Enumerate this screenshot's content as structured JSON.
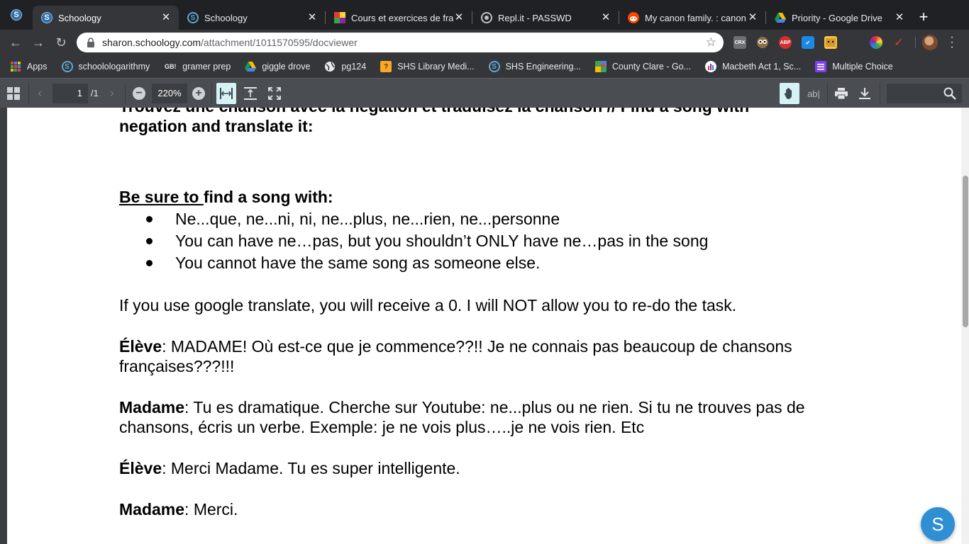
{
  "browser": {
    "pinned_tab": {
      "icon": "schoology-icon"
    },
    "tabs": [
      {
        "title": "Schoology",
        "icon": "schoology-icon",
        "active": true
      },
      {
        "title": "Schoology",
        "icon": "schoology-icon",
        "active": false
      },
      {
        "title": "Cours et exercices de fra",
        "icon": "colorful-squares-icon",
        "active": false
      },
      {
        "title": "Repl.it - PASSWD",
        "icon": "replit-icon",
        "active": false
      },
      {
        "title": "My canon family. : canon",
        "icon": "reddit-icon",
        "active": false
      },
      {
        "title": "Priority - Google Drive",
        "icon": "google-drive-icon",
        "active": false
      }
    ],
    "new_tab_label": "+",
    "url_host": "sharon.schoology.com",
    "url_path": "/attachment/1011570595/docviewer",
    "extensions": [
      "CRX",
      "owl",
      "ABP",
      "check",
      "box",
      "",
      "color-wheel",
      "swoosh"
    ],
    "bookmarks": [
      {
        "label": "Apps",
        "icon": "apps-grid-icon"
      },
      {
        "label": "schoolologarithmy",
        "icon": "schoology-icon"
      },
      {
        "label": "gramer prep",
        "icon": "gb-icon",
        "icon_text": "GB!"
      },
      {
        "label": "giggle drove",
        "icon": "google-drive-icon"
      },
      {
        "label": "pg124",
        "icon": "globe-icon"
      },
      {
        "label": "SHS Library Medi...",
        "icon": "library-icon"
      },
      {
        "label": "SHS Engineering...",
        "icon": "schoology-icon"
      },
      {
        "label": "County Clare - Go...",
        "icon": "google-maps-icon"
      },
      {
        "label": "Macbeth Act 1, Sc...",
        "icon": "macbeth-icon"
      },
      {
        "label": "Multiple Choice",
        "icon": "forms-icon"
      }
    ]
  },
  "viewer": {
    "page_current": "1",
    "page_total": "/1",
    "zoom": "220%",
    "text_tool_label": "ab"
  },
  "document": {
    "heading_top": "Trouvez une chanson avec la négation et traduisez la chanson // Find a song with",
    "heading_line2": "negation and translate it:",
    "be_sure_underlined": "Be sure to ",
    "be_sure_rest": "find a song with:",
    "bullets": [
      "Ne...que, ne...ni, ni, ne...plus, ne...rien, ne...personne",
      "You can have ne…pas, but you shouldn’t ONLY have ne…pas in the song",
      "You cannot have the same song as someone else."
    ],
    "warning": "If you use google translate, you will receive a 0. I will NOT allow you to re-do the task.",
    "dialogue": [
      {
        "speaker": "Élève",
        "text": ": MADAME! Où est-ce que je commence??!! Je ne connais pas beaucoup de chansons françaises???!!!"
      },
      {
        "speaker": "Madame",
        "text": ": Tu es dramatique. Cherche sur Youtube: ne...plus ou ne rien. Si tu ne trouves pas de chansons, écris un verbe. Exemple: je ne vois plus…..je ne vois rien. Etc"
      },
      {
        "speaker": "Élève",
        "text": ": Merci Madame. Tu es super intelligente."
      },
      {
        "speaker": "Madame",
        "text": ": Merci."
      }
    ]
  },
  "fab": {
    "label": "S"
  }
}
